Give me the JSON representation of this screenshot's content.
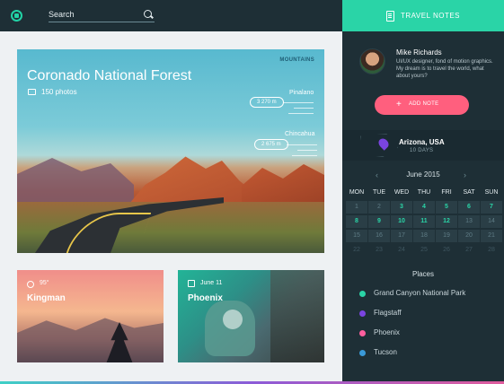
{
  "search": {
    "placeholder": "Search"
  },
  "travel_notes": {
    "title": "TRAVEL NOTES"
  },
  "hero": {
    "title": "Coronado National Forest",
    "photos": "150 photos",
    "category": "MOUNTAINS",
    "peaks": [
      {
        "name": "Pinalano",
        "altitude": "3 270 m"
      },
      {
        "name": "Chincahua",
        "altitude": "2 675 m"
      }
    ]
  },
  "cards": [
    {
      "meta": "95°",
      "name": "Kingman",
      "icon": "sun-icon"
    },
    {
      "meta": "June 11",
      "name": "Phoenix",
      "icon": "calendar-icon"
    }
  ],
  "profile": {
    "name": "Mike Richards",
    "bio": "UI/UX designer, fond of motion graphics. My dream is to travel the world, what about yours?"
  },
  "add_note": {
    "label": "ADD NOTE"
  },
  "location": {
    "name": "Arizona, USA",
    "duration": "10 DAYS"
  },
  "calendar": {
    "month": "June 2015",
    "weekdays": [
      "MON",
      "TUE",
      "WED",
      "THU",
      "FRI",
      "SAT",
      "SUN"
    ],
    "weeks": [
      [
        "1",
        "2",
        "3",
        "4",
        "5",
        "6",
        "7"
      ],
      [
        "8",
        "9",
        "10",
        "11",
        "12",
        "13",
        "14"
      ],
      [
        "15",
        "16",
        "17",
        "18",
        "19",
        "20",
        "21"
      ],
      [
        "22",
        "23",
        "24",
        "25",
        "26",
        "27",
        "28"
      ]
    ]
  },
  "places": {
    "title": "Places",
    "items": [
      {
        "name": "Grand Canyon National Park",
        "color": "#2ad4a7"
      },
      {
        "name": "Flagstaff",
        "color": "#7a44e0"
      },
      {
        "name": "Phoenix",
        "color": "#ff5f9e"
      },
      {
        "name": "Tucson",
        "color": "#3a9ad8"
      }
    ]
  },
  "colors": {
    "accent": "#2ad4a7",
    "button": "#ff5f7e",
    "sidebar": "#1e2f36"
  }
}
